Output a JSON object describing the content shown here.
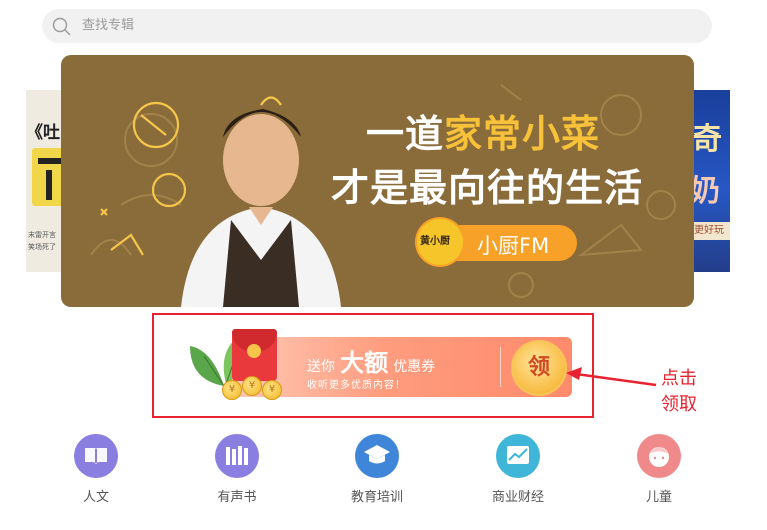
{
  "search": {
    "placeholder": "查找专辑"
  },
  "side_left": {
    "title_fragment": "《吐",
    "caption_line1": "末雷开言",
    "caption_line2": "笑场死了"
  },
  "side_right": {
    "title_fragment_1": "奇",
    "title_fragment_2": "奶",
    "tag": "更好玩"
  },
  "banner": {
    "headline_part1": "一道",
    "headline_part2": "家常小菜",
    "headline_line2": "才是最向往的生活",
    "logo_text": "黄小厨",
    "brand": "小厨FM",
    "colors": {
      "background": "#8a6c3a",
      "accent": "#f7c13a",
      "pill": "#f7a128"
    }
  },
  "coupon": {
    "line1_pre": "送你",
    "line1_big": "大额",
    "line1_post": "优惠券",
    "line2": "收听更多优质内容！",
    "claim_label": "领"
  },
  "annotation": {
    "line1": "点击",
    "line2": "领取",
    "color": "#e8232f"
  },
  "categories": [
    {
      "label": "人文",
      "icon": "book-icon",
      "color": "#8a7ee0"
    },
    {
      "label": "有声书",
      "icon": "bookshelf-icon",
      "color": "#8a7ee0"
    },
    {
      "label": "教育培训",
      "icon": "graduation-cap-icon",
      "color": "#3f86d8"
    },
    {
      "label": "商业财经",
      "icon": "chart-icon",
      "color": "#3fb6d8"
    },
    {
      "label": "儿童",
      "icon": "child-icon",
      "color": "#f08a8a"
    }
  ]
}
